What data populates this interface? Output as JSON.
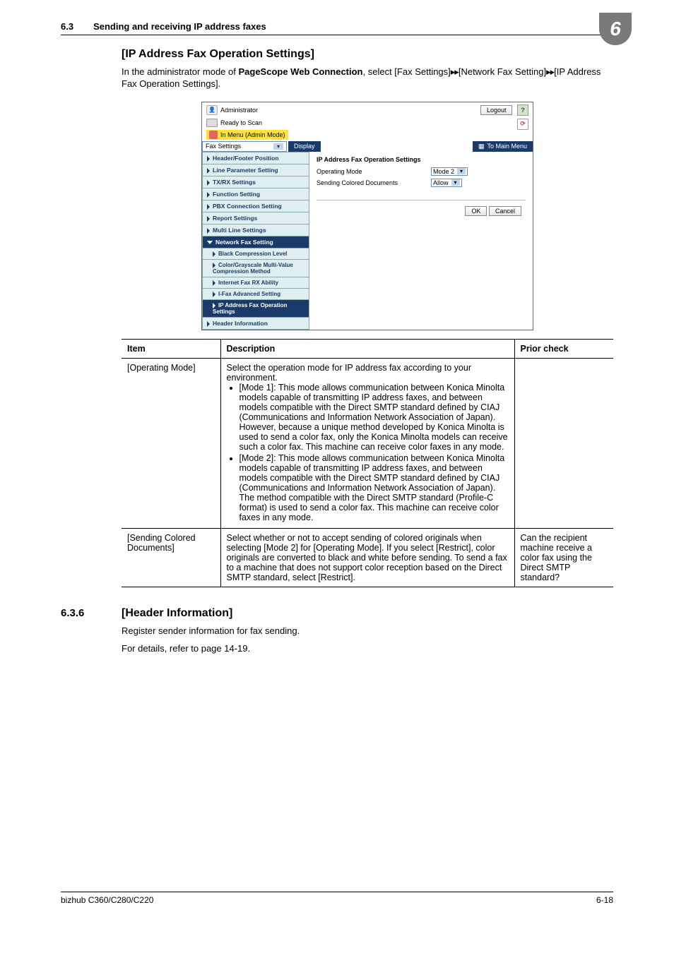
{
  "header": {
    "section_number": "6.3",
    "section_title": "Sending and receiving IP address faxes",
    "chapter_digit": "6"
  },
  "subsection_title": "[IP Address Fax Operation Settings]",
  "intro": {
    "pre": "In the administrator mode of ",
    "bold": "PageScope Web Connection",
    "post": ", select [Fax Settings]",
    "arrows1": "▸▸",
    "mid": "[Network Fax Setting]",
    "arrows2": "▸▸",
    "end": "[IP Address Fax Operation Settings]."
  },
  "screenshot": {
    "admin_label": "Administrator",
    "logout": "Logout",
    "ready": "Ready to Scan",
    "admin_mode": "In Menu (Admin Mode)",
    "dropdown": "Fax Settings",
    "display_btn": "Display",
    "main_menu_btn": "To Main Menu",
    "nav": {
      "i1": "Header/Footer Position",
      "i2": "Line Parameter Setting",
      "i3": "TX/RX Settings",
      "i4": "Function Setting",
      "i5": "PBX Connection Setting",
      "i6": "Report Settings",
      "i7": "Multi Line Settings",
      "i8": "Network Fax Setting",
      "s1": "Black Compression Level",
      "s2": "Color/Grayscale Multi-Value Compression Method",
      "s3": "Internet Fax RX Ability",
      "s4": "I-Fax Advanced Setting",
      "s5": "IP Address Fax Operation Settings",
      "i9": "Header Information"
    },
    "panel_title": "IP Address Fax Operation Settings",
    "row1_label": "Operating Mode",
    "row1_value": "Mode 2",
    "row2_label": "Sending Colored Documents",
    "row2_value": "Allow",
    "ok": "OK",
    "cancel": "Cancel"
  },
  "table": {
    "h1": "Item",
    "h2": "Description",
    "h3": "Prior check",
    "r1c1": "[Operating Mode]",
    "r1c2_lead": "Select the operation mode for IP address fax according to your environment.",
    "r1c2_b1": "[Mode 1]: This mode allows communication between Konica Minolta models capable of transmitting IP address faxes, and between models compatible with the Direct SMTP standard defined by CIAJ (Communications and Information Network Association of Japan). However, because a unique method developed by Konica Minolta is used to send a color fax, only the Konica Minolta models can receive such a color fax. This machine can receive color faxes in any mode.",
    "r1c2_b2": "[Mode 2]: This mode allows communication between Konica Minolta models capable of transmitting IP address faxes, and between models compatible with the Direct SMTP standard defined by CIAJ (Communications and Information Network Association of Japan). The method compatible with the Direct SMTP standard (Profile-C format) is used to send a color fax. This machine can receive color faxes in any mode.",
    "r1c3": "",
    "r2c1": "[Sending Colored Documents]",
    "r2c2": "Select whether or not to accept sending of colored originals when selecting [Mode 2] for [Operating Mode]. If you select [Restrict], color originals are converted to black and white before sending. To send a fax to a machine that does not support color reception based on the Direct SMTP standard, select [Restrict].",
    "r2c3": "Can the recipient machine receive a color fax using the Direct SMTP standard?"
  },
  "sec636": {
    "number": "6.3.6",
    "title": "[Header Information]",
    "p1": "Register sender information for fax sending.",
    "p2": "For details, refer to page 14-19."
  },
  "footer": {
    "left": "bizhub C360/C280/C220",
    "right": "6-18"
  }
}
